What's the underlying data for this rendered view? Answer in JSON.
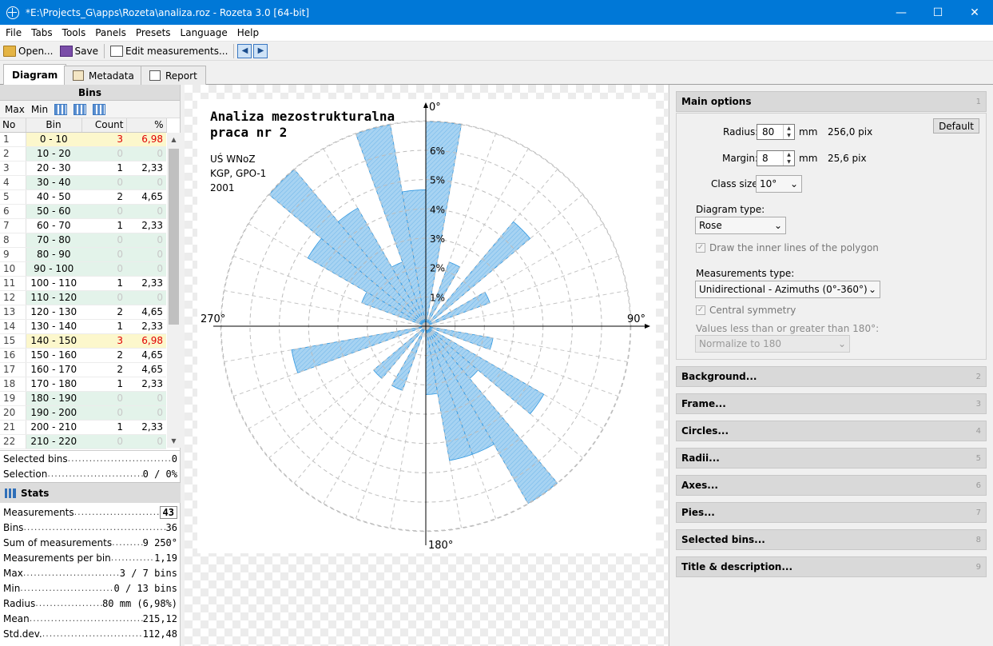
{
  "window": {
    "title": "*E:\\Projects_G\\apps\\Rozeta\\analiza.roz - Rozeta 3.0  [64-bit]"
  },
  "menu": [
    "File",
    "Tabs",
    "Tools",
    "Panels",
    "Presets",
    "Language",
    "Help"
  ],
  "toolbar": {
    "open": "Open...",
    "save": "Save",
    "edit": "Edit measurements..."
  },
  "tabs": [
    "Diagram",
    "Metadata",
    "Report"
  ],
  "bins_panel": {
    "header": "Bins",
    "max_label": "Max",
    "min_label": "Min",
    "columns": [
      "No",
      "Bin",
      "Count",
      "%"
    ],
    "rows": [
      {
        "no": "1",
        "bin": "0 - 10",
        "count": "3",
        "pct": "6,98",
        "state": "max"
      },
      {
        "no": "2",
        "bin": "10 - 20",
        "count": "0",
        "pct": "0",
        "state": "empty"
      },
      {
        "no": "3",
        "bin": "20 - 30",
        "count": "1",
        "pct": "2,33",
        "state": ""
      },
      {
        "no": "4",
        "bin": "30 - 40",
        "count": "0",
        "pct": "0",
        "state": "empty"
      },
      {
        "no": "5",
        "bin": "40 - 50",
        "count": "2",
        "pct": "4,65",
        "state": ""
      },
      {
        "no": "6",
        "bin": "50 - 60",
        "count": "0",
        "pct": "0",
        "state": "empty"
      },
      {
        "no": "7",
        "bin": "60 - 70",
        "count": "1",
        "pct": "2,33",
        "state": ""
      },
      {
        "no": "8",
        "bin": "70 - 80",
        "count": "0",
        "pct": "0",
        "state": "empty"
      },
      {
        "no": "9",
        "bin": "80 - 90",
        "count": "0",
        "pct": "0",
        "state": "empty"
      },
      {
        "no": "10",
        "bin": "90 - 100",
        "count": "0",
        "pct": "0",
        "state": "empty"
      },
      {
        "no": "11",
        "bin": "100 - 110",
        "count": "1",
        "pct": "2,33",
        "state": ""
      },
      {
        "no": "12",
        "bin": "110 - 120",
        "count": "0",
        "pct": "0",
        "state": "empty"
      },
      {
        "no": "13",
        "bin": "120 - 130",
        "count": "2",
        "pct": "4,65",
        "state": ""
      },
      {
        "no": "14",
        "bin": "130 - 140",
        "count": "1",
        "pct": "2,33",
        "state": ""
      },
      {
        "no": "15",
        "bin": "140 - 150",
        "count": "3",
        "pct": "6,98",
        "state": "max"
      },
      {
        "no": "16",
        "bin": "150 - 160",
        "count": "2",
        "pct": "4,65",
        "state": ""
      },
      {
        "no": "17",
        "bin": "160 - 170",
        "count": "2",
        "pct": "4,65",
        "state": ""
      },
      {
        "no": "18",
        "bin": "170 - 180",
        "count": "1",
        "pct": "2,33",
        "state": ""
      },
      {
        "no": "19",
        "bin": "180 - 190",
        "count": "0",
        "pct": "0",
        "state": "empty"
      },
      {
        "no": "20",
        "bin": "190 - 200",
        "count": "0",
        "pct": "0",
        "state": "empty"
      },
      {
        "no": "21",
        "bin": "200 - 210",
        "count": "1",
        "pct": "2,33",
        "state": ""
      },
      {
        "no": "22",
        "bin": "210 - 220",
        "count": "0",
        "pct": "0",
        "state": "empty"
      }
    ]
  },
  "selection": [
    {
      "label": "Selected bins",
      "value": "0"
    },
    {
      "label": "Selection",
      "value": "0 / 0%"
    }
  ],
  "stats": {
    "header": "Stats",
    "items": [
      {
        "label": "Measurements",
        "value": "43",
        "boxed": true
      },
      {
        "label": "Bins",
        "value": "36"
      },
      {
        "label": "Sum of measurements",
        "value": "9 250°"
      },
      {
        "label": "Measurements per bin",
        "value": "1,19"
      },
      {
        "label": "Max",
        "value": "3 / 7 bins"
      },
      {
        "label": "Min",
        "value": "0 / 13 bins"
      },
      {
        "label": "Radius",
        "value": "80 mm (6,98%)"
      },
      {
        "label": "Mean",
        "value": "215,12"
      },
      {
        "label": "Std.dev.",
        "value": "112,48"
      }
    ]
  },
  "diagram": {
    "title_line1": "Analiza mezostrukturalna",
    "title_line2": "praca nr 2",
    "desc": [
      "UŚ WNoZ",
      "KGP, GPO-1",
      "2001"
    ],
    "axis_labels": {
      "n": "0°",
      "e": "90°",
      "s": "180°",
      "w": "270°"
    }
  },
  "chart_data": {
    "type": "rose",
    "class_size_deg": 10,
    "scale_unit": "%",
    "max_pct": 6.98,
    "circle_labels": [
      "1%",
      "2%",
      "3%",
      "4%",
      "5%",
      "6%"
    ],
    "bins_start_deg": [
      0,
      10,
      20,
      30,
      40,
      50,
      60,
      70,
      80,
      90,
      100,
      110,
      120,
      130,
      140,
      150,
      160,
      170,
      180,
      190,
      200,
      210,
      220,
      230,
      240,
      250,
      260,
      270,
      280,
      290,
      300,
      310,
      320,
      330,
      340,
      350
    ],
    "values_pct": [
      6.98,
      0,
      2.33,
      0,
      4.65,
      0,
      2.33,
      0,
      0,
      0,
      2.33,
      0,
      4.65,
      2.33,
      6.98,
      4.65,
      4.65,
      2.33,
      0,
      0,
      2.33,
      0,
      2.33,
      0,
      0,
      4.65,
      0,
      0,
      0,
      2.33,
      4.65,
      6.98,
      4.65,
      2.33,
      6.98,
      4.65
    ],
    "fill_color": "#a7d3f2",
    "stroke_color": "#2e96df"
  },
  "right_panel": {
    "main_options": {
      "header": "Main options",
      "num": "1",
      "radius_label": "Radius:",
      "radius_value": "80",
      "radius_unit": "mm",
      "radius_pix": "256,0 pix",
      "margin_label": "Margin:",
      "margin_value": "8",
      "margin_unit": "mm",
      "margin_pix": "25,6 pix",
      "default_btn": "Default",
      "class_size_label": "Class size:",
      "class_size_value": "10°",
      "diagram_type_label": "Diagram type:",
      "diagram_type_value": "Rose",
      "inner_lines_label": "Draw the inner lines of the polygon",
      "meas_type_label": "Measurements type:",
      "meas_type_value": "Unidirectional - Azimuths (0°-360°)",
      "central_sym_label": "Central symmetry",
      "values_label": "Values less than or greater than 180°:",
      "normalize_value": "Normalize to 180"
    },
    "sections": [
      {
        "name": "Background...",
        "num": "2"
      },
      {
        "name": "Frame...",
        "num": "3"
      },
      {
        "name": "Circles...",
        "num": "4"
      },
      {
        "name": "Radii...",
        "num": "5"
      },
      {
        "name": "Axes...",
        "num": "6"
      },
      {
        "name": "Pies...",
        "num": "7"
      },
      {
        "name": "Selected bins...",
        "num": "8"
      },
      {
        "name": "Title & description...",
        "num": "9"
      }
    ]
  }
}
